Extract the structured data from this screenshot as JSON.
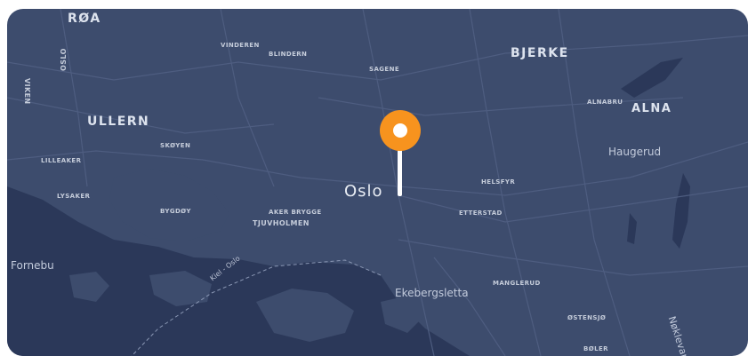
{
  "map": {
    "accent_color": "#f7931e",
    "labels": {
      "roa": "RØA",
      "vinderen": "VINDEREN",
      "blindern": "BLINDERN",
      "sagene": "SAGENE",
      "bjerke": "BJERKE",
      "viken": "VIKEN",
      "oslo_county": "OSLO",
      "ullern": "ULLERN",
      "alnabru": "ALNABRU",
      "alna": "ALNA",
      "haugerud": "Haugerud",
      "skoyen": "SKØYEN",
      "lilleaker": "LILLEAKER",
      "lysaker": "LYSAKER",
      "bygdoy": "BYGDØY",
      "aker_brygge": "AKER BRYGGE",
      "tjuvholmen": "TJUVHOLMEN",
      "oslo": "Oslo",
      "helsfyr": "HELSFYR",
      "etterstad": "ETTERSTAD",
      "fornebu": "Fornebu",
      "kiel_oslo": "Kiel - Oslo",
      "ekebergsletta": "Ekebergsletta",
      "manglerud": "MANGLERUD",
      "ostensjo": "ØSTENSJØ",
      "bøler": "BØLER",
      "noklevann": "Nøklevann"
    },
    "pin_icon": "location-pin-icon"
  }
}
